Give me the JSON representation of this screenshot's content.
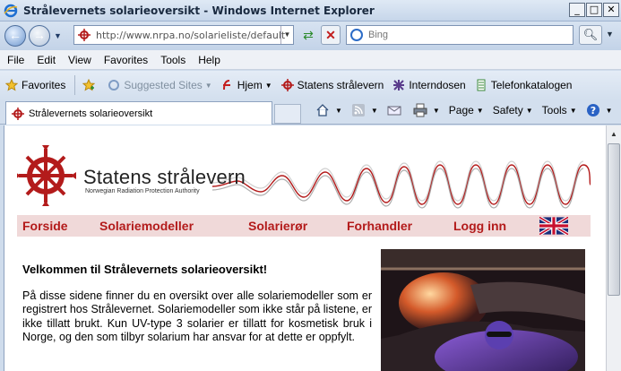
{
  "window": {
    "title": "Strålevernets solarieoversikt - Windows Internet Explorer",
    "controls": [
      "_",
      "□",
      "✕"
    ]
  },
  "address": {
    "url": "http://www.nrpa.no/solarieliste/default.as",
    "search_placeholder": "Bing"
  },
  "menu": [
    "File",
    "Edit",
    "View",
    "Favorites",
    "Tools",
    "Help"
  ],
  "favorites_bar": {
    "favorites_label": "Favorites",
    "items": [
      "Suggested Sites",
      "Hjem",
      "Statens strålevern",
      "Interndosen",
      "Telefonkatalogen"
    ]
  },
  "tab": {
    "label": "Strålevernets solarieoversikt"
  },
  "commands": [
    "Page",
    "Safety",
    "Tools"
  ],
  "site": {
    "brand": "Statens strålevern",
    "brand_sub": "Norwegian Radiation Protection Authority",
    "nav": [
      "Forside",
      "Solariemodeller",
      "Solarierør",
      "Forhandler",
      "Logg inn"
    ],
    "heading": "Velkommen til Strålevernets solarieoversikt!",
    "intro": "På disse sidene finner du en oversikt over alle solariemodeller som er registrert hos Strålevernet. Solariemodeller som ikke står på listene, er ikke tillatt brukt. Kun UV-type 3 solarier er tillatt for kosmetisk bruk i Norge, og den som tilbyr solarium har ansvar for at dette er oppfylt."
  },
  "colors": {
    "brand_red": "#b31b1b",
    "nav_bg": "#f0d9d9"
  }
}
